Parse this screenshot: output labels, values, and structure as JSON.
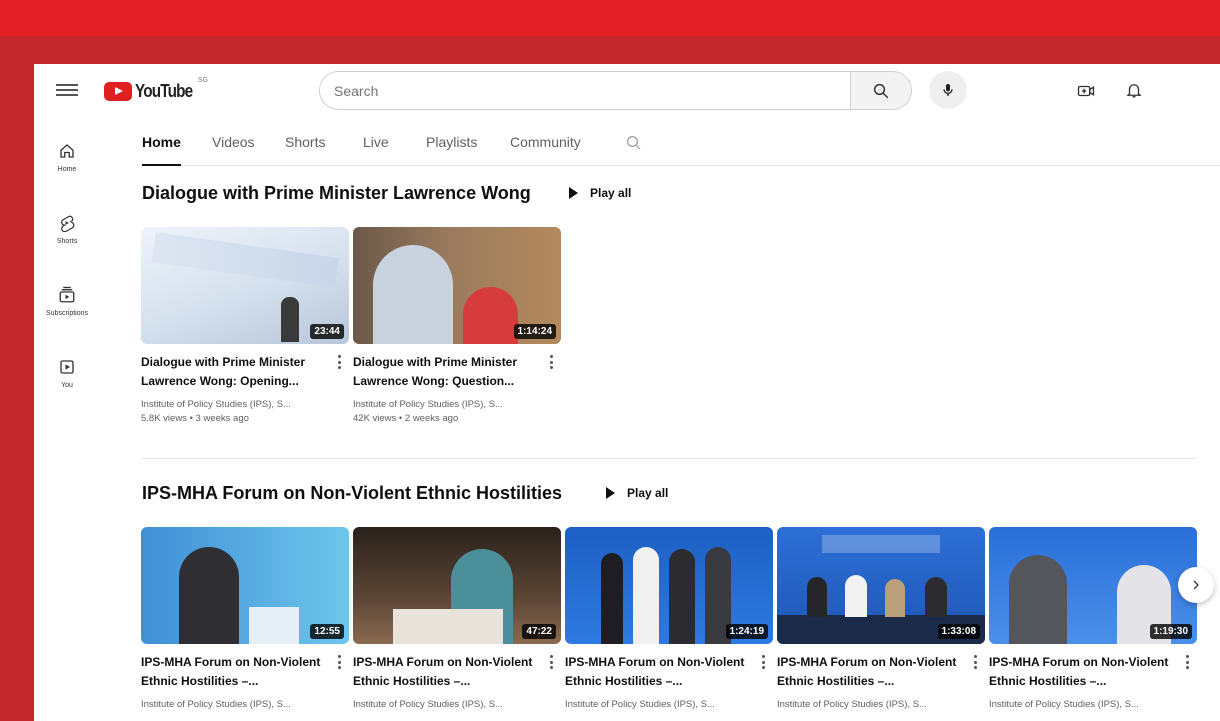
{
  "header": {
    "logo_text": "YouTube",
    "logo_region": "SG",
    "search_placeholder": "Search"
  },
  "sidebar": {
    "items": [
      {
        "label": "Home",
        "icon": "home-icon"
      },
      {
        "label": "Shorts",
        "icon": "shorts-icon"
      },
      {
        "label": "Subscriptions",
        "icon": "subscriptions-icon"
      },
      {
        "label": "You",
        "icon": "you-icon"
      }
    ]
  },
  "tabs": [
    "Home",
    "Videos",
    "Shorts",
    "Live",
    "Playlists",
    "Community"
  ],
  "active_tab": "Home",
  "sections": [
    {
      "title": "Dialogue with Prime Minister Lawrence Wong",
      "play_all": "Play all",
      "videos": [
        {
          "title": "Dialogue with Prime Minister Lawrence Wong: Opening...",
          "channel": "Institute of Policy Studies (IPS), S...",
          "meta": "5.8K views • 3 weeks ago",
          "duration": "23:44"
        },
        {
          "title": "Dialogue with Prime Minister Lawrence Wong: Question...",
          "channel": "Institute of Policy Studies (IPS), S...",
          "meta": "42K views • 2 weeks ago",
          "duration": "1:14:24"
        }
      ]
    },
    {
      "title": "IPS-MHA Forum on Non-Violent Ethnic Hostilities",
      "play_all": "Play all",
      "videos": [
        {
          "title": "IPS-MHA Forum on Non-Violent Ethnic Hostilities –...",
          "channel": "Institute of Policy Studies (IPS), S...",
          "duration": "12:55"
        },
        {
          "title": "IPS-MHA Forum on Non-Violent Ethnic Hostilities –...",
          "channel": "Institute of Policy Studies (IPS), S...",
          "duration": "47:22"
        },
        {
          "title": "IPS-MHA Forum on Non-Violent Ethnic Hostilities –...",
          "channel": "Institute of Policy Studies (IPS), S...",
          "duration": "1:24:19"
        },
        {
          "title": "IPS-MHA Forum on Non-Violent Ethnic Hostilities –...",
          "channel": "Institute of Policy Studies (IPS), S...",
          "duration": "1:33:08"
        },
        {
          "title": "IPS-MHA Forum on Non-Violent Ethnic Hostilities –...",
          "channel": "Institute of Policy Studies (IPS), S...",
          "duration": "1:19:30"
        }
      ]
    }
  ],
  "colors": {
    "accent_red": "#e41f26",
    "frame_red": "#c2272d",
    "logo_red": "#e02020"
  }
}
